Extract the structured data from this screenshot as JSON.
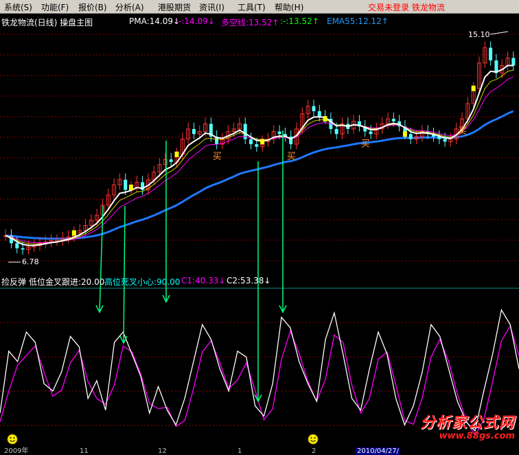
{
  "menu": {
    "items": [
      {
        "label": "系统(S)"
      },
      {
        "label": "功能(F)"
      },
      {
        "label": "报价(B)"
      },
      {
        "label": "分析(A)"
      },
      {
        "label": "港股期货"
      },
      {
        "label": "资讯(I)"
      },
      {
        "label": "工具(T)"
      },
      {
        "label": "帮助(H)"
      }
    ],
    "status": "交易未登录  铁龙物流"
  },
  "legend": {
    "title": "铁龙物流(日线) 操盘主图",
    "pma": "PMA:14.09↓",
    "v2": ":-:14.09↓",
    "duokong": "多空线:13.52↑",
    "v4": ":-:13.52↑",
    "ema55": "EMA55:12.12↑"
  },
  "sub_legend": {
    "title": "捡反弹",
    "low": "低位金叉跟进:20.00",
    "high": "高位死叉小心:90.00",
    "c1": "C1:40.33↓",
    "c2": "C2:53.38↓"
  },
  "annotations": {
    "high_price": "15.10",
    "low_price": "6.78",
    "buy": "买"
  },
  "dates": [
    "2009年",
    "11",
    "12",
    "1",
    "2",
    "2010/04/27/"
  ],
  "watermark": {
    "title": "分析家公式网",
    "url": "www.88gs.com"
  },
  "colors": {
    "up": "#ff3232",
    "down": "#54ffff",
    "pma_line": "#ffffff",
    "mid_line": "#ff00ff",
    "ema_line": "#1e78ff",
    "yellow": "#ffff00",
    "arrow": "#00ff80",
    "osc_fast": "#ffffff",
    "osc_slow": "#ff00ff",
    "grid": "#8b0000"
  },
  "chart_data": {
    "type": "candlestick",
    "title": "铁龙物流(日线) 操盘主图",
    "ylim": [
      6.78,
      15.1
    ],
    "series": [
      {
        "name": "PMA",
        "last": 14.09
      },
      {
        "name": "多空线",
        "last": 13.52
      },
      {
        "name": "EMA55",
        "last": 12.12
      }
    ],
    "closes": [
      7.4,
      7.1,
      6.9,
      6.85,
      6.95,
      7.0,
      7.1,
      7.15,
      7.2,
      7.2,
      7.3,
      7.35,
      7.5,
      7.6,
      7.8,
      8.0,
      8.2,
      8.6,
      9.0,
      9.4,
      9.6,
      9.2,
      9.3,
      9.5,
      9.2,
      9.6,
      9.9,
      10.2,
      10.4,
      10.3,
      10.6,
      11.2,
      11.6,
      11.4,
      11.5,
      11.8,
      11.3,
      11.0,
      11.2,
      11.5,
      11.6,
      11.8,
      11.2,
      11.0,
      10.9,
      11.1,
      11.2,
      11.5,
      11.4,
      11.3,
      11.0,
      11.6,
      12.2,
      12.5,
      12.3,
      12.1,
      12.0,
      11.6,
      11.4,
      11.8,
      11.6,
      11.9,
      11.7,
      11.5,
      11.4,
      11.6,
      11.8,
      12.0,
      11.9,
      11.7,
      11.4,
      11.2,
      11.3,
      11.5,
      11.4,
      11.3,
      11.2,
      11.1,
      11.2,
      11.6,
      12.0,
      12.6,
      13.2,
      14.2,
      14.8,
      14.3,
      13.8,
      14.1,
      14.4,
      14.1
    ]
  }
}
